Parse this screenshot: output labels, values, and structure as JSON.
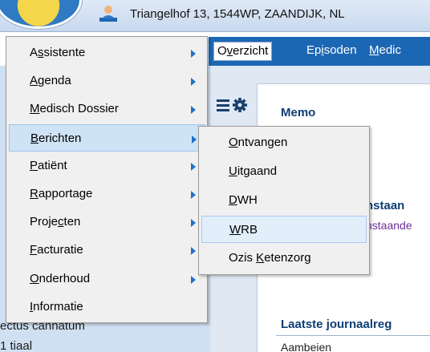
{
  "header": {
    "address": "Triangelhof 13, 1544WP, ZAANDIJK, NL"
  },
  "tabs": [
    {
      "label": "Overzicht",
      "underline_index": 1,
      "active": true
    },
    {
      "label": "Episoden",
      "underline_index": 2,
      "active": false
    },
    {
      "label": "Medic",
      "underline_index": 0,
      "active": false
    }
  ],
  "main_menu": {
    "items": [
      {
        "label": "Assistente",
        "underline_index": 1,
        "has_submenu": true
      },
      {
        "label": "Agenda",
        "underline_index": 0,
        "has_submenu": true
      },
      {
        "label": "Medisch Dossier",
        "underline_index": 0,
        "has_submenu": true
      },
      {
        "label": "Berichten",
        "underline_index": 0,
        "has_submenu": true,
        "highlighted": true
      },
      {
        "label": "Patiënt",
        "underline_index": 0,
        "has_submenu": true
      },
      {
        "label": "Rapportage",
        "underline_index": 0,
        "has_submenu": true
      },
      {
        "label": "Projecten",
        "underline_index": 5,
        "has_submenu": true
      },
      {
        "label": "Facturatie",
        "underline_index": 0,
        "has_submenu": true
      },
      {
        "label": "Onderhoud",
        "underline_index": 0,
        "has_submenu": true
      },
      {
        "label": "Informatie",
        "underline_index": 0,
        "has_submenu": false
      }
    ]
  },
  "sub_menu": {
    "items": [
      {
        "label": "Ontvangen",
        "underline_index": 0
      },
      {
        "label": "Uitgaand",
        "underline_index": 0
      },
      {
        "label": "DWH",
        "underline_index": 0
      },
      {
        "label": "WRB",
        "underline_index": 0,
        "highlighted": true
      },
      {
        "label": "Ozis Ketenzorg",
        "underline_index": 5
      }
    ]
  },
  "content": {
    "memo_title": "Memo",
    "bestaand_heading": "nstaan",
    "bestaand_link": "nstaande",
    "journaal_title": "Laatste journaalreg",
    "journaal_first_entry": "Aambeien"
  },
  "left_panel": {
    "text_1": "ectus cannatum",
    "text_2": "1 tiaal"
  },
  "colors": {
    "tab_bar": "#1c67b4",
    "heading": "#0e3e74",
    "menu_highlight": "#cfe3f6",
    "submenu_arrow": "#1f72c8"
  },
  "icons": [
    "logo",
    "person-icon",
    "list-icon",
    "gear-icon",
    "submenu-arrow-icon"
  ]
}
